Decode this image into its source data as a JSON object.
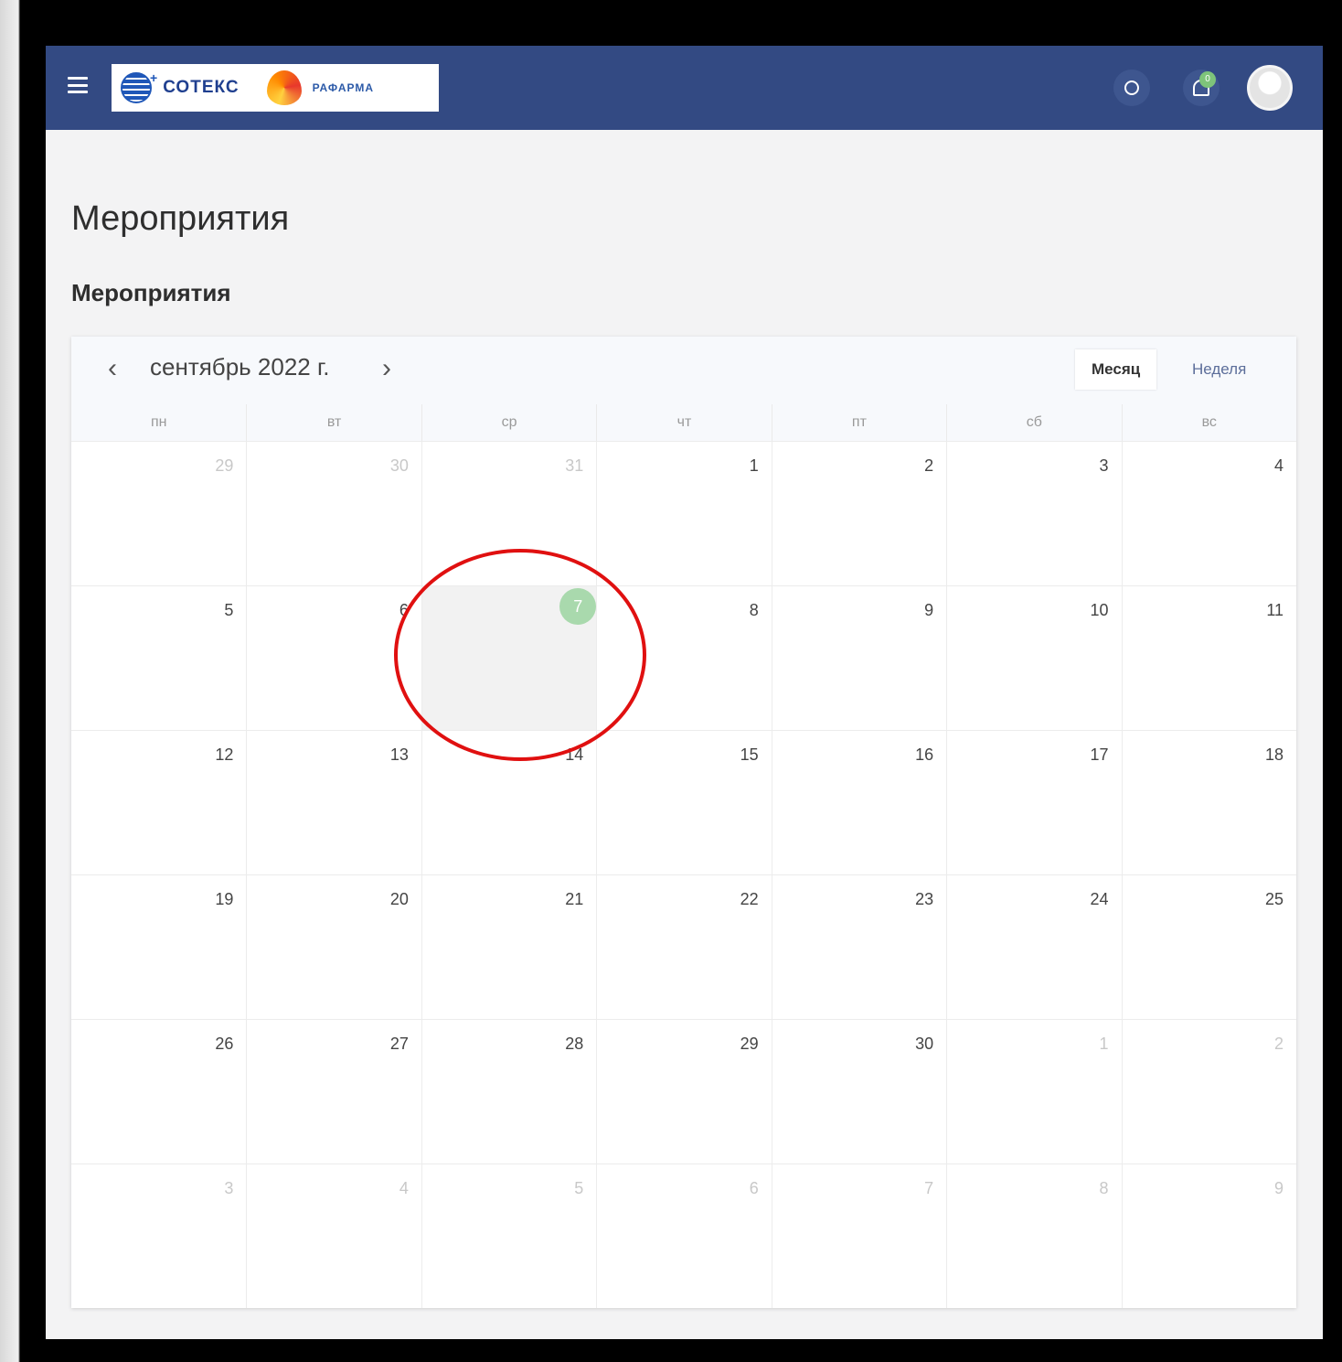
{
  "header": {
    "logo_primary": "СОТЕКС",
    "logo_secondary": "РАФАРМА",
    "notification_count": "0"
  },
  "page": {
    "title": "Мероприятия",
    "section_title": "Мероприятия"
  },
  "calendar": {
    "month_label": "сентябрь 2022 г.",
    "view_month": "Месяц",
    "view_week": "Неделя",
    "weekdays": [
      "пн",
      "вт",
      "ср",
      "чт",
      "пт",
      "сб",
      "вс"
    ],
    "days": [
      {
        "n": "29",
        "other": true
      },
      {
        "n": "30",
        "other": true
      },
      {
        "n": "31",
        "other": true
      },
      {
        "n": "1"
      },
      {
        "n": "2"
      },
      {
        "n": "3"
      },
      {
        "n": "4"
      },
      {
        "n": "5"
      },
      {
        "n": "6"
      },
      {
        "n": "7",
        "today": true
      },
      {
        "n": "8"
      },
      {
        "n": "9"
      },
      {
        "n": "10"
      },
      {
        "n": "11"
      },
      {
        "n": "12"
      },
      {
        "n": "13"
      },
      {
        "n": "14"
      },
      {
        "n": "15"
      },
      {
        "n": "16"
      },
      {
        "n": "17"
      },
      {
        "n": "18"
      },
      {
        "n": "19"
      },
      {
        "n": "20"
      },
      {
        "n": "21"
      },
      {
        "n": "22"
      },
      {
        "n": "23"
      },
      {
        "n": "24"
      },
      {
        "n": "25"
      },
      {
        "n": "26"
      },
      {
        "n": "27"
      },
      {
        "n": "28"
      },
      {
        "n": "29"
      },
      {
        "n": "30"
      },
      {
        "n": "1",
        "other": true
      },
      {
        "n": "2",
        "other": true
      },
      {
        "n": "3",
        "other": true
      },
      {
        "n": "4",
        "other": true
      },
      {
        "n": "5",
        "other": true
      },
      {
        "n": "6",
        "other": true
      },
      {
        "n": "7",
        "other": true
      },
      {
        "n": "8",
        "other": true
      },
      {
        "n": "9",
        "other": true
      }
    ]
  },
  "colors": {
    "header_bg": "#334a83",
    "today_badge": "#a9d9ad",
    "annotation": "#e01010"
  }
}
